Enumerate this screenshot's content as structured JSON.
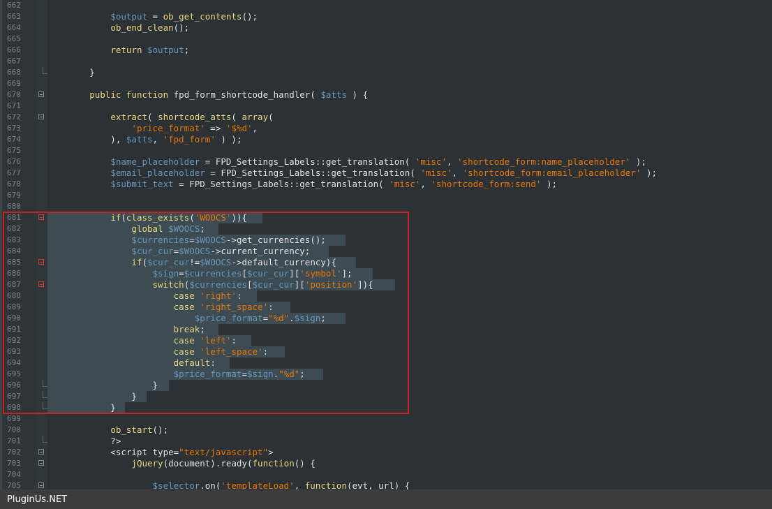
{
  "footer": {
    "watermark": "PluginUs.NET"
  },
  "code_lines": [
    {
      "n": "662",
      "t": ""
    },
    {
      "n": "663",
      "t": "            $output = ob_get_contents();"
    },
    {
      "n": "664",
      "t": "            ob_end_clean();"
    },
    {
      "n": "665",
      "t": ""
    },
    {
      "n": "666",
      "t": "            return $output;"
    },
    {
      "n": "667",
      "t": ""
    },
    {
      "n": "668",
      "t": "        }"
    },
    {
      "n": "669",
      "t": ""
    },
    {
      "n": "670",
      "t": "        public function fpd_form_shortcode_handler( $atts ) {"
    },
    {
      "n": "671",
      "t": ""
    },
    {
      "n": "672",
      "t": "            extract( shortcode_atts( array("
    },
    {
      "n": "673",
      "t": "                'price_format' => '$%d',"
    },
    {
      "n": "674",
      "t": "            ), $atts, 'fpd_form' ) );"
    },
    {
      "n": "675",
      "t": ""
    },
    {
      "n": "676",
      "t": "            $name_placeholder = FPD_Settings_Labels::get_translation( 'misc', 'shortcode_form:name_placeholder' );"
    },
    {
      "n": "677",
      "t": "            $email_placeholder = FPD_Settings_Labels::get_translation( 'misc', 'shortcode_form:email_placeholder' );"
    },
    {
      "n": "678",
      "t": "            $submit_text = FPD_Settings_Labels::get_translation( 'misc', 'shortcode_form:send' );"
    },
    {
      "n": "679",
      "t": ""
    },
    {
      "n": "680",
      "t": ""
    },
    {
      "n": "681",
      "t": "            if(class_exists('WOOCS')){"
    },
    {
      "n": "682",
      "t": "                global $WOOCS;"
    },
    {
      "n": "683",
      "t": "                $currencies=$WOOCS->get_currencies();"
    },
    {
      "n": "684",
      "t": "                $cur_cur=$WOOCS->current_currency;"
    },
    {
      "n": "685",
      "t": "                if($cur_cur!=$WOOCS->default_currency){"
    },
    {
      "n": "686",
      "t": "                    $sign=$currencies[$cur_cur]['symbol'];"
    },
    {
      "n": "687",
      "t": "                    switch($currencies[$cur_cur]['position']){"
    },
    {
      "n": "688",
      "t": "                        case 'right':"
    },
    {
      "n": "689",
      "t": "                        case 'right_space':"
    },
    {
      "n": "690",
      "t": "                            $price_format=\"%d\".$sign;"
    },
    {
      "n": "691",
      "t": "                        break;"
    },
    {
      "n": "692",
      "t": "                        case 'left':"
    },
    {
      "n": "693",
      "t": "                        case 'left_space':"
    },
    {
      "n": "694",
      "t": "                        default:"
    },
    {
      "n": "695",
      "t": "                        $price_format=$sign.\"%d\";"
    },
    {
      "n": "696",
      "t": "                    }"
    },
    {
      "n": "697",
      "t": "                }"
    },
    {
      "n": "698",
      "t": "            }"
    },
    {
      "n": "699",
      "t": ""
    },
    {
      "n": "700",
      "t": "            ob_start();"
    },
    {
      "n": "701",
      "t": "            ?>"
    },
    {
      "n": "702",
      "t": "            <script type=\"text/javascript\">"
    },
    {
      "n": "703",
      "t": "                jQuery(document).ready(function() {"
    },
    {
      "n": "704",
      "t": ""
    },
    {
      "n": "705",
      "t": "                    $selector.on('templateLoad', function(evt, url) {"
    }
  ],
  "fold_markers": [
    "670",
    "672",
    "681",
    "685",
    "687",
    "702",
    "703",
    "705"
  ],
  "fold_markers_highlighted": [
    "681",
    "685",
    "687"
  ],
  "fold_ends": [
    "668",
    "696",
    "697",
    "698",
    "701"
  ],
  "highlight_region": {
    "from": "681",
    "to": "698",
    "border_color": "#cc1f1f"
  },
  "colors": {
    "background": "#2b3134",
    "gutter": "#2e3438",
    "selection": "#3d4b52",
    "keyword": "#e8d77f",
    "variable": "#6897bb",
    "string": "#ec7600",
    "text": "#e0e2e4"
  }
}
